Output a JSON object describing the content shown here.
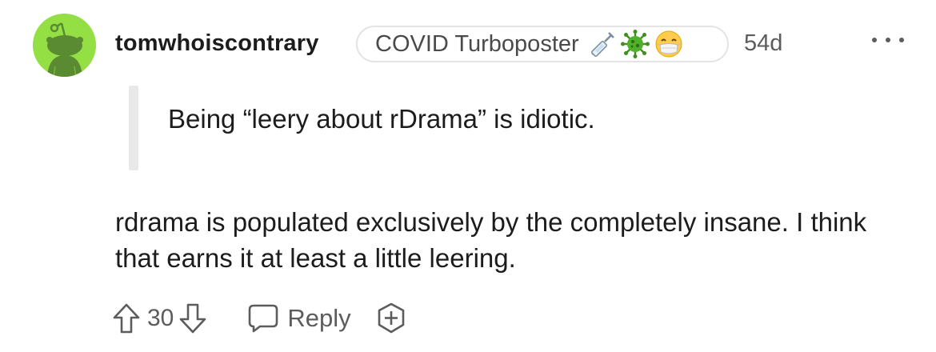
{
  "comment": {
    "username": "tomwhoiscontrary",
    "flair": {
      "text": "COVID Turboposter",
      "emojis": [
        "syringe-icon",
        "virus-icon",
        "mask-face-icon"
      ]
    },
    "age": "54d",
    "quote": "Being “leery about rDrama” is idiotic.",
    "body": "rdrama is populated exclusively by the completely insane. I think that earns it at least a little leering.",
    "score": "30",
    "reply_label": "Reply"
  },
  "colors": {
    "avatar_bg": "#94e044",
    "avatar_figure": "#5a8a32",
    "text": "#1c1c1c",
    "meta": "#5c5c5c",
    "border": "#e4e4e4"
  }
}
